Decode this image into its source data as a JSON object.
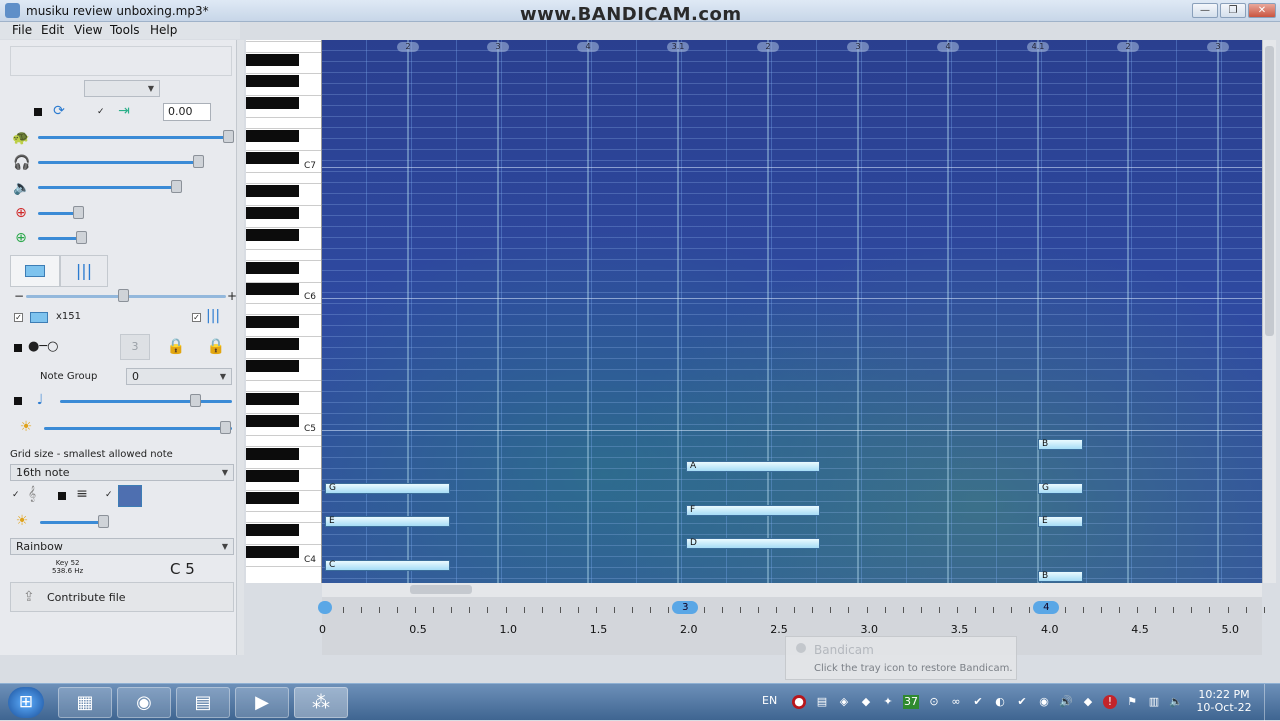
{
  "window": {
    "title": "musiku review unboxing.mp3*",
    "watermark": "www.BANDICAM.com",
    "controls": [
      "—",
      "❐",
      "✕"
    ]
  },
  "menu": [
    "File",
    "Edit",
    "View",
    "Tools",
    "Help"
  ],
  "sidebar": {
    "position_value": "0.00",
    "note_count_label": "x151",
    "note_group_label": "Note Group",
    "note_group_value": "0",
    "grid_label": "Grid size - smallest allowed note",
    "grid_value": "16th note",
    "colormap_value": "Rainbow",
    "key_label": "Key 52",
    "freq_label": "538.6 Hz",
    "current_note": "C 5",
    "contribute_label": "Contribute file",
    "speed_level": 0.95,
    "headphone_volume": 0.78,
    "speaker_volume": 0.67,
    "zoom_in_level": 0.31,
    "zoom_out_level": 0.32,
    "note_size_level": 0.51,
    "metronome_level": 0.77,
    "brightness_level": 0.98,
    "contrast_level": 0.42
  },
  "piano": {
    "octave_labels": [
      "C7",
      "C6",
      "C5",
      "C4"
    ]
  },
  "notes": [
    {
      "label": "G",
      "start": 0.0,
      "end": 0.69,
      "lane": "G4"
    },
    {
      "label": "E",
      "start": 0.0,
      "end": 0.69,
      "lane": "E4"
    },
    {
      "label": "C",
      "start": 0.0,
      "end": 0.69,
      "lane": "C4"
    },
    {
      "label": "A",
      "start": 2.0,
      "end": 2.74,
      "lane": "A4"
    },
    {
      "label": "F",
      "start": 2.0,
      "end": 2.74,
      "lane": "F4"
    },
    {
      "label": "D",
      "start": 2.0,
      "end": 2.74,
      "lane": "D4"
    },
    {
      "label": "B",
      "start": 3.95,
      "end": 4.2,
      "lane": "B4"
    },
    {
      "label": "G",
      "start": 3.95,
      "end": 4.2,
      "lane": "G4"
    },
    {
      "label": "E",
      "start": 3.95,
      "end": 4.2,
      "lane": "E4"
    },
    {
      "label": "B",
      "start": 3.95,
      "end": 4.2,
      "lane": "B3"
    }
  ],
  "beat_labels": [
    "2",
    "3",
    "4",
    "3.1",
    "2",
    "3",
    "4",
    "4.1",
    "2",
    "3"
  ],
  "timeline": {
    "labels": [
      "0",
      "0.5",
      "1.0",
      "1.5",
      "2.0",
      "2.5",
      "3.0",
      "3.5",
      "4.0",
      "4.5",
      "5.0"
    ],
    "markers": [
      {
        "text": "3",
        "at": 1.93
      },
      {
        "text": "4",
        "at": 3.93
      }
    ]
  },
  "toast": {
    "title": "Bandicam",
    "message": "Click the tray icon to restore Bandicam."
  },
  "taskbar": {
    "lang": "EN",
    "time": "10:22 PM",
    "date": "10-Oct-22",
    "tray_badge": "37"
  }
}
